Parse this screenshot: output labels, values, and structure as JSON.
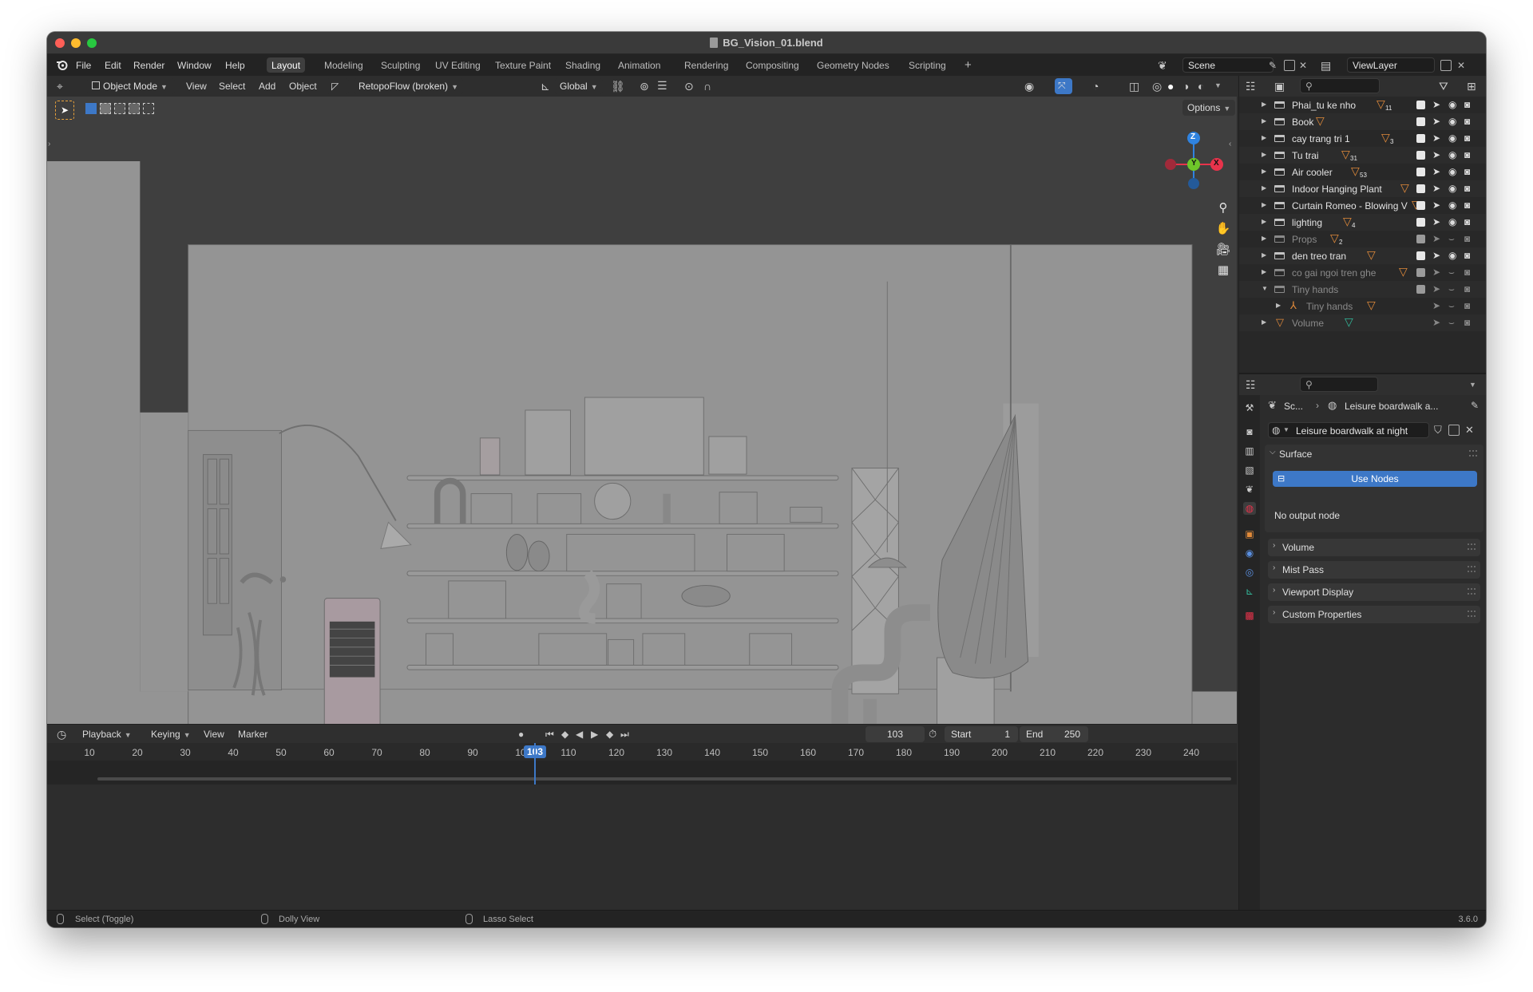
{
  "window": {
    "title": "BG_Vision_01.blend"
  },
  "menu": [
    "File",
    "Edit",
    "Render",
    "Window",
    "Help"
  ],
  "workspaces": [
    "Layout",
    "Modeling",
    "Sculpting",
    "UV Editing",
    "Texture Paint",
    "Shading",
    "Animation",
    "Rendering",
    "Compositing",
    "Geometry Nodes",
    "Scripting"
  ],
  "workspace_add": "+",
  "scene": {
    "name": "Scene"
  },
  "view_layer": {
    "name": "ViewLayer"
  },
  "viewport_header": {
    "mode": "Object Mode",
    "menus": [
      "View",
      "Select",
      "Add",
      "Object"
    ],
    "addon": "RetopoFlow (broken)",
    "orientation": "Global"
  },
  "viewport": {
    "options_label": "Options"
  },
  "gizmo": {
    "z": "Z",
    "y": "Y",
    "x": "X"
  },
  "timeline": {
    "menus": [
      "Playback",
      "Keying",
      "View",
      "Marker"
    ],
    "current_frame": "103",
    "start_label": "Start",
    "start": "1",
    "end_label": "End",
    "end": "250",
    "ruler_ticks": [
      "10",
      "20",
      "30",
      "40",
      "50",
      "60",
      "70",
      "80",
      "90",
      "10",
      "110",
      "120",
      "130",
      "140",
      "150",
      "160",
      "170",
      "180",
      "190",
      "200",
      "210",
      "220",
      "230",
      "240"
    ],
    "playhead_frame": 103
  },
  "statusbar": {
    "left": "Select (Toggle)",
    "middle": "Dolly View",
    "right": "Lasso Select",
    "version": "3.6.0"
  },
  "outliner": {
    "items": [
      {
        "name": "Phai_tu ke nho",
        "badge": "11",
        "dim": false
      },
      {
        "name": "Book",
        "badge": "",
        "dim": false
      },
      {
        "name": "cay trang tri 1",
        "badge": "3",
        "dim": false
      },
      {
        "name": "Tu trai",
        "badge": "31",
        "dim": false
      },
      {
        "name": "Air cooler",
        "badge": "53",
        "dim": false
      },
      {
        "name": "Indoor Hanging Plant",
        "badge": "",
        "dim": false
      },
      {
        "name": "Curtain Romeo - Blowing V",
        "badge": "",
        "dim": false
      },
      {
        "name": "lighting",
        "badge": "4",
        "dim": false
      },
      {
        "name": "Props",
        "badge": "2",
        "dim": true
      },
      {
        "name": "den treo tran",
        "badge": "",
        "dim": false
      },
      {
        "name": "co gai ngoi tren ghe",
        "badge": "",
        "dim": true
      },
      {
        "name": "Tiny hands",
        "badge": "",
        "dim": true
      },
      {
        "name": "Tiny hands",
        "badge": "",
        "dim": true
      },
      {
        "name": "Volume",
        "badge": "",
        "dim": true
      }
    ]
  },
  "properties": {
    "breadcrumb_scene": "Sc...",
    "breadcrumb_world": "Leisure boardwalk a...",
    "world_name": "Leisure boardwalk at night",
    "panels": {
      "surface": "Surface",
      "use_nodes": "Use Nodes",
      "no_output": "No output node",
      "volume": "Volume",
      "mist": "Mist Pass",
      "viewport_display": "Viewport Display",
      "custom_props": "Custom Properties"
    }
  },
  "colors": {
    "accent_blue": "#3d78c7",
    "axis_x": "#e8334b",
    "axis_y": "#6ec62a",
    "axis_z": "#2f83e0",
    "collection_badge": "#e08a3a"
  }
}
